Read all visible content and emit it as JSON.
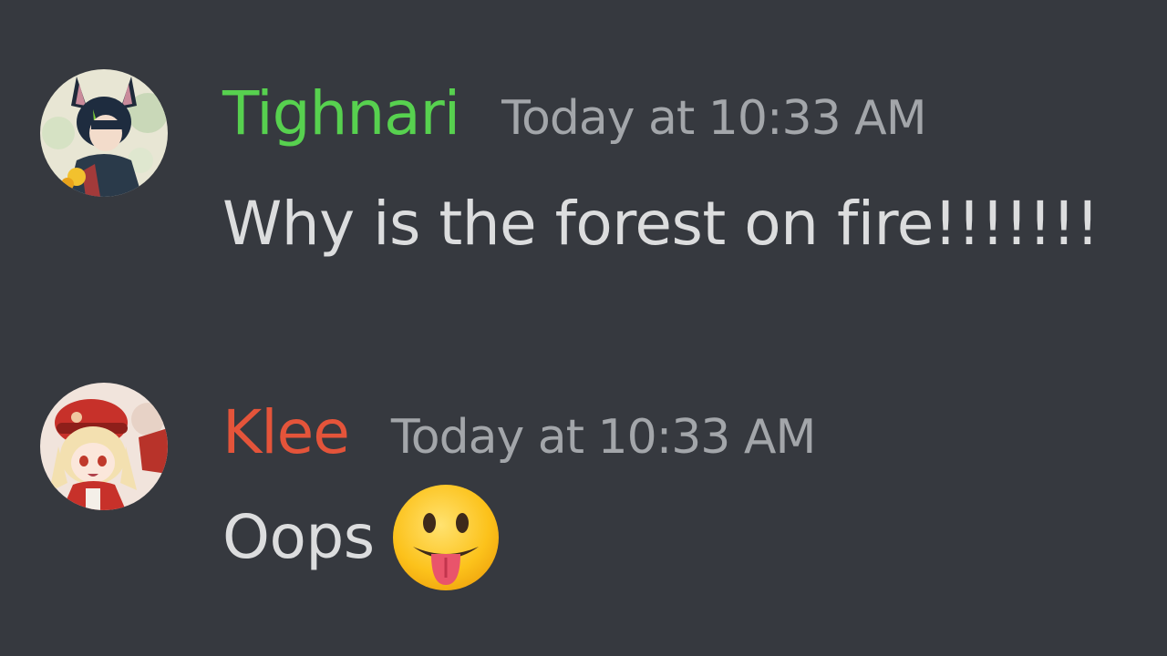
{
  "messages": [
    {
      "username": "Tighnari",
      "username_color": "#57d14f",
      "timestamp": "Today at 10:33 AM",
      "content": "Why is the forest on fire!!!!!!!",
      "avatar_icon": "tighnari-avatar"
    },
    {
      "username": "Klee",
      "username_color": "#e4543a",
      "timestamp": "Today at 10:33 AM",
      "content": "Oops",
      "avatar_icon": "klee-avatar",
      "emoji": "face-with-tongue-emoji"
    }
  ],
  "colors": {
    "background": "#36393f",
    "timestamp": "#a3a6aa",
    "message_text": "#dcddde"
  }
}
